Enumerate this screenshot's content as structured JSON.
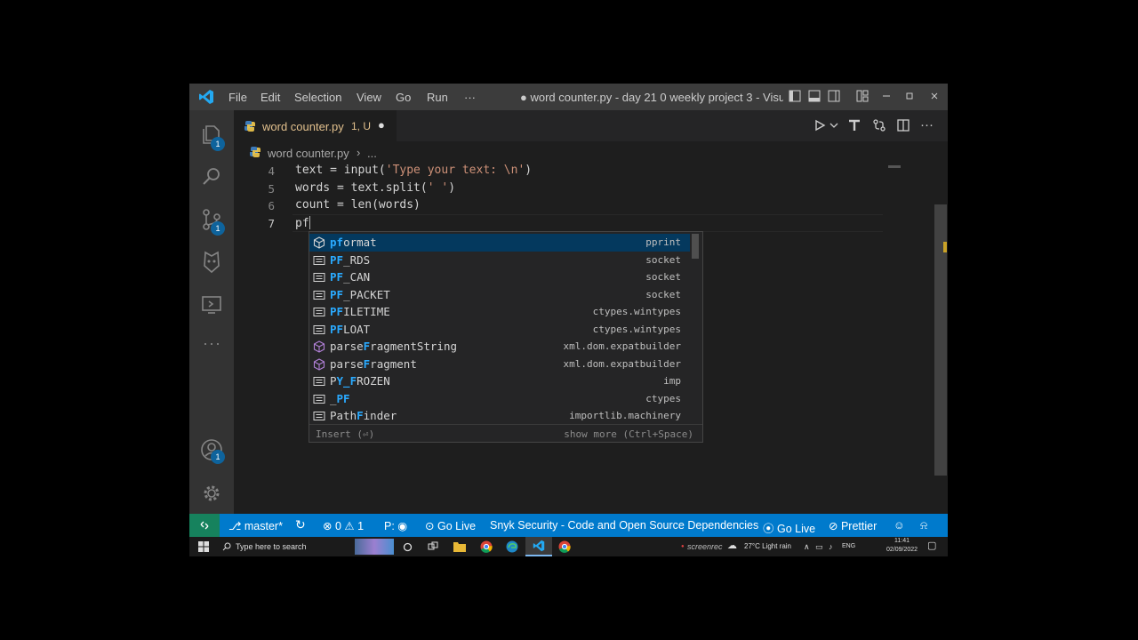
{
  "menu": [
    "File",
    "Edit",
    "Selection",
    "View",
    "Go",
    "Run",
    "···"
  ],
  "window_title": "● word counter.py - day 21 0 weekly project 3 - Visu...",
  "activity_badges": [
    "1",
    "1",
    "1"
  ],
  "tab": {
    "label": "word counter.py",
    "status": "1, U",
    "dirty": "●"
  },
  "breadcrumb": {
    "file": "word counter.py",
    "sep": "›",
    "more": "..."
  },
  "code_lines": [
    {
      "n": "4",
      "pre": "text = input(",
      "str": "'Type your text: \\n'",
      "post": ")"
    },
    {
      "n": "5",
      "pre": "words = text.split(",
      "str": "' '",
      "post": ")"
    },
    {
      "n": "6",
      "pre": "count = len(words)",
      "str": "",
      "post": ""
    },
    {
      "n": "7",
      "pre": "pf",
      "str": "",
      "post": ""
    }
  ],
  "suggestions": [
    {
      "match": "pf",
      "rest": "ormat",
      "detail": "pprint",
      "kind": "module"
    },
    {
      "match": "PF",
      "rest": "_RDS",
      "detail": "socket",
      "kind": "constant"
    },
    {
      "match": "PF",
      "rest": "_CAN",
      "detail": "socket",
      "kind": "constant"
    },
    {
      "match": "PF",
      "rest": "_PACKET",
      "detail": "socket",
      "kind": "constant"
    },
    {
      "match": "PF",
      "rest": "ILETIME",
      "detail": "ctypes.wintypes",
      "kind": "constant"
    },
    {
      "match": "PF",
      "rest": "LOAT",
      "detail": "ctypes.wintypes",
      "kind": "constant"
    },
    {
      "pre": "parse",
      "match": "F",
      "rest": "ragmentString",
      "detail": "xml.dom.expatbuilder",
      "kind": "method"
    },
    {
      "pre": "parse",
      "match": "F",
      "rest": "ragment",
      "detail": "xml.dom.expatbuilder",
      "kind": "method"
    },
    {
      "pre": "P",
      "match": "Y_F",
      "rest": "ROZEN",
      "detail": "imp",
      "kind": "constant"
    },
    {
      "pre": "_",
      "match": "PF",
      "rest": "",
      "detail": "ctypes",
      "kind": "constant"
    },
    {
      "pre": "Path",
      "match": "F",
      "rest": "inder",
      "detail": "importlib.machinery",
      "kind": "constant"
    }
  ],
  "suggest_footer": {
    "insert": "Insert (⏎)",
    "more": "show more (Ctrl+Space)"
  },
  "status": {
    "branch": "master*",
    "errors": "0",
    "warnings": "1",
    "ports": "P:",
    "go_live": "Go Live",
    "snyk": "Snyk Security - Code and Open Source Dependencies",
    "go_live_2": "Go Live",
    "prettier": "Prettier"
  },
  "taskbar": {
    "search": "Type here to search",
    "weather": "27°C  Light rain",
    "lang": "ENG",
    "time": "11:41",
    "date": "02/09/2022",
    "watermark": "screenrec"
  }
}
